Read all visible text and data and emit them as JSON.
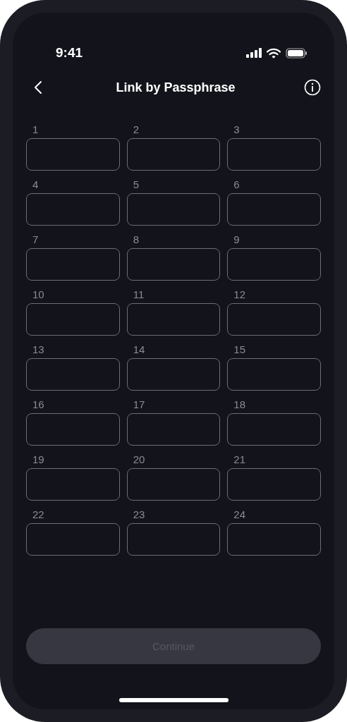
{
  "status_bar": {
    "time": "9:41"
  },
  "header": {
    "title": "Link by Passphrase"
  },
  "words": [
    {
      "label": "1"
    },
    {
      "label": "2"
    },
    {
      "label": "3"
    },
    {
      "label": "4"
    },
    {
      "label": "5"
    },
    {
      "label": "6"
    },
    {
      "label": "7"
    },
    {
      "label": "8"
    },
    {
      "label": "9"
    },
    {
      "label": "10"
    },
    {
      "label": "11"
    },
    {
      "label": "12"
    },
    {
      "label": "13"
    },
    {
      "label": "14"
    },
    {
      "label": "15"
    },
    {
      "label": "16"
    },
    {
      "label": "17"
    },
    {
      "label": "18"
    },
    {
      "label": "19"
    },
    {
      "label": "20"
    },
    {
      "label": "21"
    },
    {
      "label": "22"
    },
    {
      "label": "23"
    },
    {
      "label": "24"
    }
  ],
  "continue_button": {
    "label": "Continue",
    "disabled": true
  }
}
